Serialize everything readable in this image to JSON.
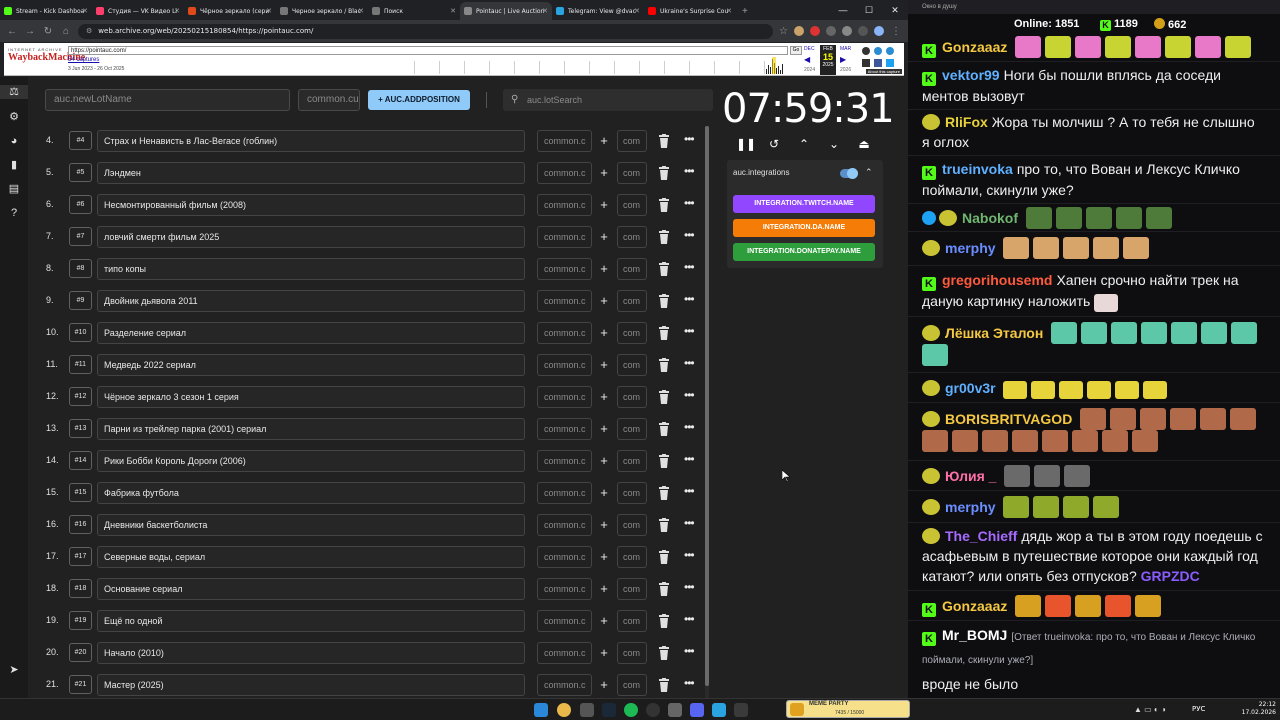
{
  "browser": {
    "tabs": [
      {
        "label": "Stream - Kick Dashboa",
        "color": "#53fc18"
      },
      {
        "label": "Студия — VK Видео Li",
        "color": "#ff3e6c"
      },
      {
        "label": "Чёрное зеркало (сери",
        "color": "#e04a1a"
      },
      {
        "label": "Черное зеркало / Blac",
        "color": "#4a4a4a"
      },
      {
        "label": "Поиск",
        "color": "#4a4a4a"
      },
      {
        "label": "Pointauc | Live Auction",
        "color": "#5b5b5b",
        "active": true
      },
      {
        "label": "Telegram: View @dvac",
        "color": "#2aa4e0"
      },
      {
        "label": "Ukraine's Surprise Cou",
        "color": "#ff0000"
      }
    ],
    "new_tab": "+",
    "url": "web.archive.org/web/20250215180854/https://pointauc.com/"
  },
  "wayback": {
    "logo_top": "INTERNET ARCHIVE",
    "logo": "WaybackMachine",
    "url": "https://pointauc.com/",
    "go": "Go",
    "captures": "54 captures",
    "range": "3 Jun 2023 - 26 Oct 2025",
    "cal_prev": "DEC",
    "cal_month": "FEB",
    "cal_next": "MAR",
    "cal_day": "15",
    "cal_year_prev": "2024",
    "cal_year": "2025",
    "cal_year_next": "2026",
    "about": "About this capture"
  },
  "auc": {
    "new_lot_placeholder": "auc.newLotName",
    "amount_placeholder": "common.cur",
    "add_position": "+ AUC.ADDPOSITION",
    "search_placeholder": "auc.lotSearch",
    "timer": "07:59:31",
    "integrations_title": "auc.integrations",
    "integrations": [
      {
        "label": "INTEGRATION.TWITCH.NAME",
        "color": "#9146ff"
      },
      {
        "label": "INTEGRATION.DA.NAME",
        "color": "#f57d07"
      },
      {
        "label": "INTEGRATION.DONATEPAY.NAME",
        "color": "#2e9e3c"
      }
    ],
    "amount_cell": "common.c",
    "amount2_cell": "com",
    "lots": [
      {
        "num": "4.",
        "id": "#4",
        "name": "Страх и Ненависть в Лас-Вегасе (гоблин)"
      },
      {
        "num": "5.",
        "id": "#5",
        "name": "Лэндмен"
      },
      {
        "num": "6.",
        "id": "#6",
        "name": "Несмонтированный фильм (2008)"
      },
      {
        "num": "7.",
        "id": "#7",
        "name": "ловчий смерти фильм 2025"
      },
      {
        "num": "8.",
        "id": "#8",
        "name": "типо копы"
      },
      {
        "num": "9.",
        "id": "#9",
        "name": "Двойник дьявола 2011"
      },
      {
        "num": "10.",
        "id": "#10",
        "name": "Разделение сериал"
      },
      {
        "num": "11.",
        "id": "#11",
        "name": "Медведь 2022 сериал"
      },
      {
        "num": "12.",
        "id": "#12",
        "name": "Чёрное зеркало 3 сезон 1 серия"
      },
      {
        "num": "13.",
        "id": "#13",
        "name": "Парни из трейлер парка (2001) сериал"
      },
      {
        "num": "14.",
        "id": "#14",
        "name": "Рики Бобби Король Дороги (2006)"
      },
      {
        "num": "15.",
        "id": "#15",
        "name": "Фабрика футбола"
      },
      {
        "num": "16.",
        "id": "#16",
        "name": "Дневники баскетболиста"
      },
      {
        "num": "17.",
        "id": "#17",
        "name": "Северные воды, сериал"
      },
      {
        "num": "18.",
        "id": "#18",
        "name": "Основание сериал"
      },
      {
        "num": "19.",
        "id": "#19",
        "name": "Ещё по одной"
      },
      {
        "num": "20.",
        "id": "#20",
        "name": "Начало (2010)"
      },
      {
        "num": "21.",
        "id": "#21",
        "name": "Мастер (2025)"
      }
    ]
  },
  "chat": {
    "window_title": "Окно в душу",
    "online_label": "Online:",
    "online_count": "1851",
    "kick_count": "1189",
    "other_count": "662",
    "messages": [
      {
        "user": "Gonzaaaz",
        "color": "#f5c842",
        "text": ""
      },
      {
        "user": "vektor99",
        "color": "#5fb0ff",
        "text": "Ноги бы пошли вплясь да соседи ментов вызовут"
      },
      {
        "user": "RliFox",
        "color": "#e8d23a",
        "text": "Жора ты молчиш ? А то тебя не слышно я оглох"
      },
      {
        "user": "trueinvoka",
        "color": "#5fb0ff",
        "text": "про то, что Вован и Лексус Кличко поймали, скинули уже?"
      },
      {
        "user": "Nabokof",
        "color": "#6fb56f",
        "text": ""
      },
      {
        "user": "merphy",
        "color": "#6a8eff",
        "text": ""
      },
      {
        "user": "gregorihousemd",
        "color": "#ff5a3c",
        "text": "Хапен срочно найти трек на даную картинку наложить"
      },
      {
        "user": "Лёшка Эталон",
        "color": "#f5c842",
        "text": ""
      },
      {
        "user": "gr00v3r",
        "color": "#5fb0ff",
        "text": ""
      },
      {
        "user": "BORISBRITVAGOD",
        "color": "#f5c842",
        "text": ""
      },
      {
        "user": "Юлия _",
        "color": "#ff6fa8",
        "text": ""
      },
      {
        "user": "merphy",
        "color": "#6a8eff",
        "text": ""
      },
      {
        "user": "The_Chieff",
        "color": "#a86bff",
        "text": "дядь жор а ты в этом году поедешь с асафьевым в путешествие которое они каждый год катают? или опять без отпусков?",
        "mention": "GRPZDC"
      },
      {
        "user": "Gonzaaaz",
        "color": "#f5c842",
        "text": ""
      },
      {
        "user": "Mr_BOMJ",
        "color": "#ffffff",
        "reply": "[Ответ trueinvoka: про то, что Вован и Лексус Кличко поймали, скинули уже?]",
        "text": "вроде не было"
      }
    ]
  },
  "taskbar": {
    "widget_title": "MEME PARTY",
    "widget_value": "7435 / 15000",
    "lang": "РУС",
    "time": "22:12",
    "date": "17.02.2026"
  }
}
